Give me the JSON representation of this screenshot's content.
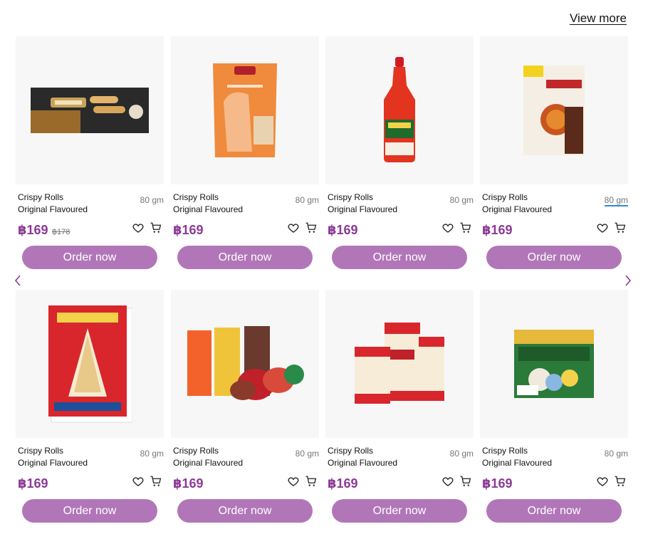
{
  "header": {
    "view_more": "View more"
  },
  "navigation": {
    "prev_icon": "chevron-left-icon",
    "next_icon": "chevron-right-icon",
    "accent": "#8b3a95"
  },
  "colors": {
    "brand": "#8b3a95",
    "button": "#b176b8",
    "image_bg": "#f7f7f7"
  },
  "products": [
    {
      "line1": "Crispy Rolls",
      "line2": "Original Flavoured",
      "weight": "80 gm",
      "price": "฿169",
      "old_price": "฿178",
      "button": "Order now",
      "image": "crispy-rolls-box"
    },
    {
      "line1": "Crispy Rolls",
      "line2": "Original Flavoured",
      "weight": "80 gm",
      "price": "฿169",
      "old_price": "",
      "button": "Order now",
      "image": "thai-tea-pouch"
    },
    {
      "line1": "Crispy Rolls",
      "line2": "Original Flavoured",
      "weight": "80 gm",
      "price": "฿169",
      "old_price": "",
      "button": "Order now",
      "image": "chili-sauce-bottle"
    },
    {
      "line1": "Crispy Rolls",
      "line2": "Original Flavoured",
      "weight": "80 gm",
      "price": "฿169",
      "old_price": "",
      "button": "Order now",
      "image": "khao-soi-seasoning-pack"
    },
    {
      "line1": "Crispy Rolls",
      "line2": "Original Flavoured",
      "weight": "80 gm",
      "price": "฿169",
      "old_price": "",
      "button": "Order now",
      "image": "rice-bag"
    },
    {
      "line1": "Crispy Rolls",
      "line2": "Original Flavoured",
      "weight": "80 gm",
      "price": "฿169",
      "old_price": "",
      "button": "Order now",
      "image": "instant-noodle-cups"
    },
    {
      "line1": "Crispy Rolls",
      "line2": "Original Flavoured",
      "weight": "80 gm",
      "price": "฿169",
      "old_price": "",
      "button": "Order now",
      "image": "noodle-packs"
    },
    {
      "line1": "Crispy Rolls",
      "line2": "Original Flavoured",
      "weight": "80 gm",
      "price": "฿169",
      "old_price": "",
      "button": "Order now",
      "image": "dessert-box"
    }
  ],
  "icons": {
    "wishlist": "heart-icon",
    "cart": "cart-icon"
  }
}
